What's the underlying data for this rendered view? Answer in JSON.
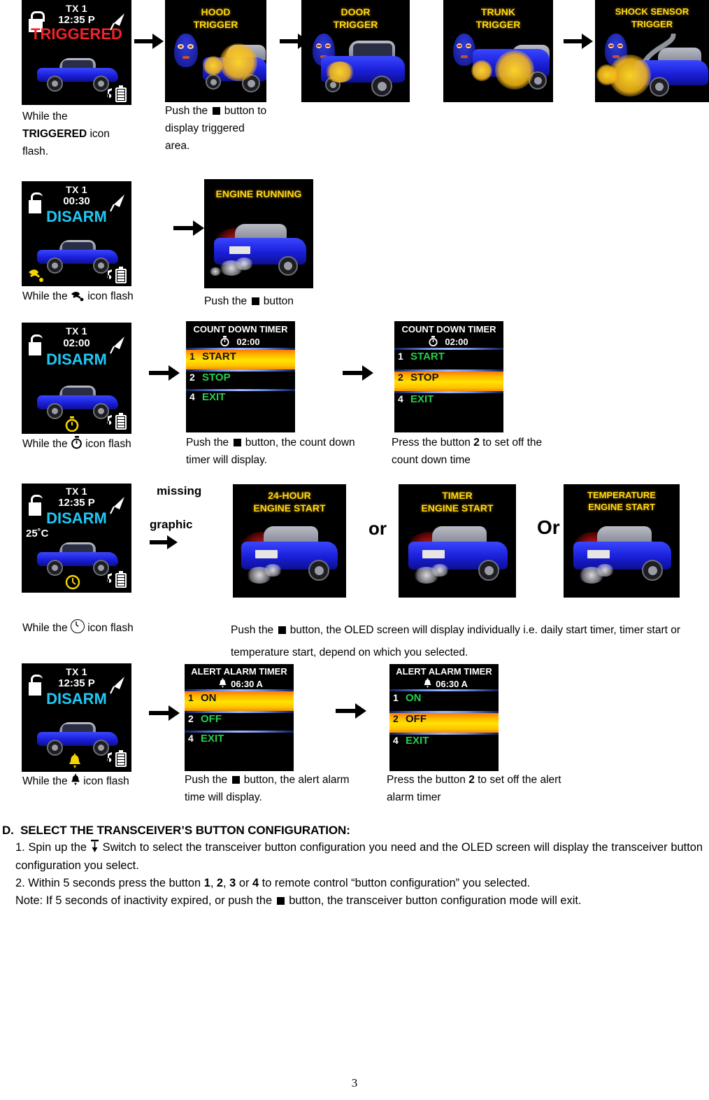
{
  "page": {
    "number": "3"
  },
  "rows": {
    "triggered": {
      "status_screen": {
        "tx": "TX 1",
        "time": "12:35 P",
        "state": "TRIGGERED",
        "lock_icon": "lock-closed-icon",
        "antenna_icon": "antenna-icon",
        "note_icon": "music-note-icon",
        "battery_icon": "battery-icon"
      },
      "trigger_screens": [
        {
          "title_line1": "HOOD",
          "title_line2": "TRIGGER",
          "name": "hood-trigger-screen"
        },
        {
          "title_line1": "DOOR",
          "title_line2": "TRIGGER",
          "name": "door-trigger-screen"
        },
        {
          "title_line1": "TRUNK",
          "title_line2": "TRIGGER",
          "name": "trunk-trigger-screen"
        },
        {
          "title_line1": "SHOCK SENSOR",
          "title_line2": "TRIGGER",
          "name": "shock-sensor-trigger-screen"
        }
      ],
      "caption_left_a": "While the ",
      "caption_left_b": "TRIGGERED",
      "caption_left_c": " icon flash.",
      "caption_right_a": "Push the ",
      "caption_right_b": " button to display triggered area."
    },
    "engine_running": {
      "status_screen": {
        "tx": "TX 1",
        "time": "00:30",
        "state": "DISARM",
        "lock_icon": "lock-open-icon",
        "antenna_icon": "antenna-icon",
        "flash_icon": "horn-icon"
      },
      "result_screen": {
        "title": "ENGINE RUNNING",
        "name": "engine-running-screen"
      },
      "caption_left_a": "While the ",
      "caption_left_b": " icon flash",
      "caption_right_a": "Push the ",
      "caption_right_b": " button"
    },
    "count_down": {
      "status_screen": {
        "tx": "TX 1",
        "time": "02:00",
        "state": "DISARM",
        "flash_icon": "stopwatch-icon"
      },
      "menu_a": {
        "title": "COUNT DOWN TIMER",
        "sub_time": "02:00",
        "sub_icon": "stopwatch-icon",
        "rows": [
          {
            "num": "1",
            "label": "START",
            "highlighted": true
          },
          {
            "num": "2",
            "label": "STOP",
            "highlighted": false
          },
          {
            "num": "4",
            "label": "EXIT",
            "highlighted": false
          }
        ]
      },
      "menu_b": {
        "title": "COUNT DOWN TIMER",
        "sub_time": "02:00",
        "sub_icon": "stopwatch-icon",
        "rows": [
          {
            "num": "1",
            "label": "START",
            "highlighted": false
          },
          {
            "num": "2",
            "label": "STOP",
            "highlighted": true
          },
          {
            "num": "4",
            "label": "EXIT",
            "highlighted": false
          }
        ]
      },
      "caption_left_a": "While the ",
      "caption_left_b": " icon flash",
      "caption_mid_a": "Push the ",
      "caption_mid_b": " button, the count down timer will display.",
      "caption_right_a": "Press the button ",
      "caption_right_num": "2",
      "caption_right_b": " to set off the count down time"
    },
    "engine_start": {
      "status_screen": {
        "tx": "TX 1",
        "time": "12:35 P",
        "state": "DISARM",
        "temperature": "25˚C",
        "flash_icon": "clock-icon"
      },
      "missing_graphic_line1": "missing",
      "missing_graphic_line2": "graphic",
      "options": [
        {
          "title_line1": "24-HOUR",
          "title_line2": "ENGINE START",
          "name": "24-hour-engine-start-screen"
        },
        {
          "title_line1": "TIMER",
          "title_line2": "ENGINE START",
          "name": "timer-engine-start-screen"
        },
        {
          "title_line1": "TEMPERATURE",
          "title_line2": "ENGINE START",
          "name": "temperature-engine-start-screen"
        }
      ],
      "or_1": "or",
      "or_2": "Or",
      "caption_left_a": "While the ",
      "caption_left_b": " icon flash",
      "caption_right_a": "Push the ",
      "caption_right_b": " button, the OLED screen will display individually i.e. daily start timer, timer start or temperature start, depend on which you selected."
    },
    "alert_alarm": {
      "status_screen": {
        "tx": "TX 1",
        "time": "12:35 P",
        "state": "DISARM",
        "flash_icon": "bell-icon"
      },
      "menu_a": {
        "title": "ALERT ALARM TIMER",
        "sub_time": "06:30 A",
        "sub_icon": "bell-icon",
        "rows": [
          {
            "num": "1",
            "label": "ON",
            "highlighted": true
          },
          {
            "num": "2",
            "label": "OFF",
            "highlighted": false
          },
          {
            "num": "4",
            "label": "EXIT",
            "highlighted": false
          }
        ]
      },
      "menu_b": {
        "title": "ALERT ALARM TIMER",
        "sub_time": "06:30 A",
        "sub_icon": "bell-icon",
        "rows": [
          {
            "num": "1",
            "label": "ON",
            "highlighted": false
          },
          {
            "num": "2",
            "label": "OFF",
            "highlighted": true
          },
          {
            "num": "4",
            "label": "EXIT",
            "highlighted": false
          }
        ]
      },
      "caption_left_a": "While the ",
      "caption_left_b": " icon flash",
      "caption_mid_a": "Push the ",
      "caption_mid_b": " button, the alert alarm time will display.",
      "caption_right_a": "Press the button ",
      "caption_right_num": "2",
      "caption_right_b": " to set off the alert alarm timer"
    }
  },
  "section_d": {
    "letter": "D.",
    "heading": "SELECT THE TRANSCEIVER’S BUTTON CONFIGURATION:",
    "item1_a": "1. Spin up the ",
    "item1_b": " Switch to select the transceiver button configuration you need and the OLED screen will display the transceiver button configuration you select.",
    "item2_a": "2. Within 5 seconds press the button ",
    "item2_n1": "1",
    "item2_s1": ", ",
    "item2_n2": "2",
    "item2_s2": ", ",
    "item2_n3": "3",
    "item2_s3": " or ",
    "item2_n4": "4",
    "item2_b": " to remote control “button configuration” you selected.",
    "item3_a": "Note: If 5 seconds of inactivity expired, or push the ",
    "item3_b": " button, the transceiver button configuration mode will exit."
  },
  "colors": {
    "triggered_red": "#f2222a",
    "disarm_cyan": "#1fc8f5",
    "title_yellow": "#ffd814",
    "menu_green": "#25d04a",
    "highlight_orange": "#ffb300",
    "separator_blue": "#9fb8ff"
  }
}
